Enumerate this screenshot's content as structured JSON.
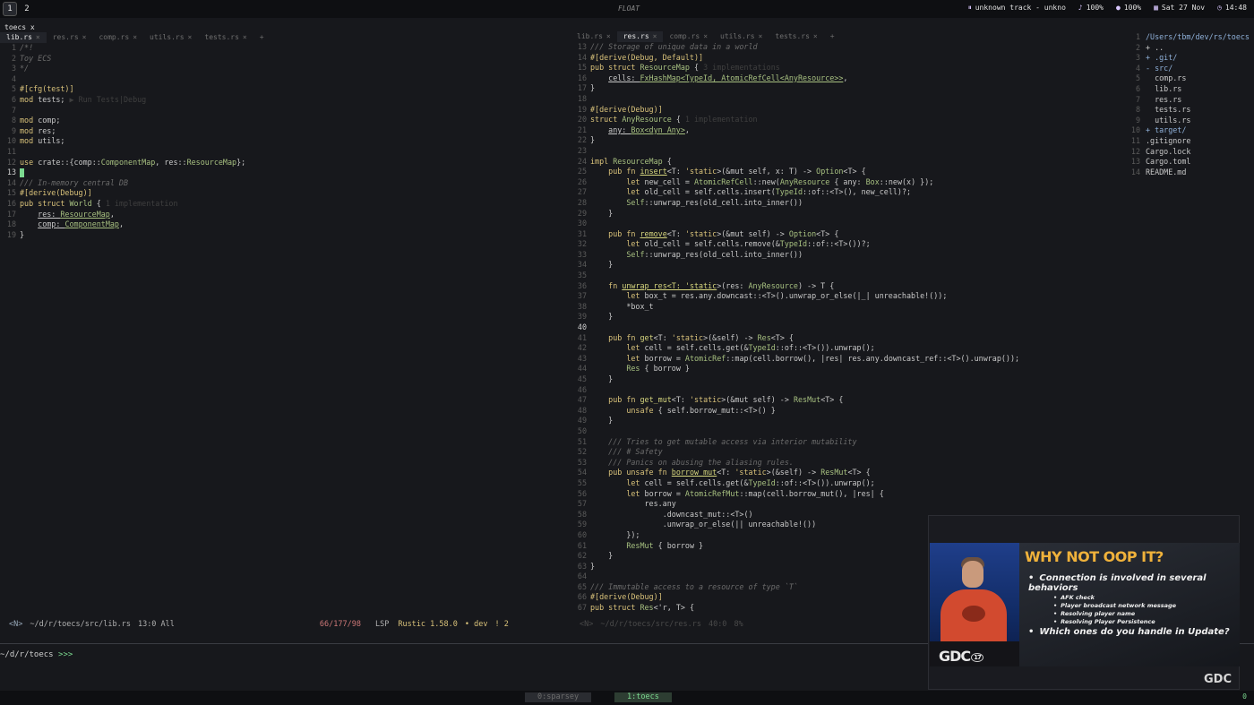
{
  "topbar": {
    "workspaces": [
      "1",
      "2"
    ],
    "float_label": "FLOAT",
    "status": {
      "music": "unknown track - unkno",
      "volume": "100%",
      "mic": "100%",
      "date": "Sat 27 Nov",
      "time": "14:48"
    }
  },
  "left": {
    "header_tab": "toecs x",
    "tabs": [
      "lib.rs",
      "res.rs",
      "comp.rs",
      "utils.rs",
      "tests.rs"
    ],
    "active_tab": 0,
    "statusline": {
      "mode": "<N>",
      "path": "~/d/r/toecs/src/lib.rs",
      "pos": "13:0 All",
      "stats": "66/177/98",
      "lsp": "LSP",
      "toolchain": "Rustic 1.58.0",
      "branch": "• dev",
      "warn": "! 2"
    }
  },
  "middle": {
    "tabs": [
      "lib.rs",
      "res.rs",
      "comp.rs",
      "utils.rs",
      "tests.rs"
    ],
    "active_tab": 1,
    "statusline": {
      "mode": "<N>",
      "path": "~/d/r/toecs/src/res.rs",
      "pos": "40:0",
      "pct": "8%"
    }
  },
  "tree": {
    "entries": [
      {
        "n": "1",
        "t": "/Users/tbm/dev/rs/toecs"
      },
      {
        "n": "2",
        "t": "+ .."
      },
      {
        "n": "3",
        "t": "+ .git/"
      },
      {
        "n": "4",
        "t": "- src/"
      },
      {
        "n": "5",
        "t": "  comp.rs"
      },
      {
        "n": "6",
        "t": "  lib.rs"
      },
      {
        "n": "7",
        "t": "  res.rs"
      },
      {
        "n": "8",
        "t": "  tests.rs"
      },
      {
        "n": "9",
        "t": "  utils.rs"
      },
      {
        "n": "10",
        "t": "+ target/"
      },
      {
        "n": "11",
        "t": ".gitignore"
      },
      {
        "n": "12",
        "t": "Cargo.lock"
      },
      {
        "n": "13",
        "t": "Cargo.toml"
      },
      {
        "n": "14",
        "t": "README.md"
      }
    ]
  },
  "terminal": {
    "prompt": "~/d/r/toecs",
    "arrows": ">>>"
  },
  "bottombar": {
    "tab0": "0:sparsey",
    "tab1": "1:toecs",
    "right": "0"
  },
  "video": {
    "slide_title": "WHY NOT OOP IT?",
    "bullet1": "Connection is involved in several behaviors",
    "sub": [
      "AFK check",
      "Player broadcast network message",
      "Resolving player name",
      "Resolving Player Persistence"
    ],
    "bullet2": "Which ones do you handle in Update?",
    "podium_logo": "GDC",
    "podium_num": "17",
    "corner_logo": "GDC"
  },
  "colors": {
    "accent": "#7bd88f",
    "keyword": "#d9c27a",
    "type": "#a7c080"
  }
}
